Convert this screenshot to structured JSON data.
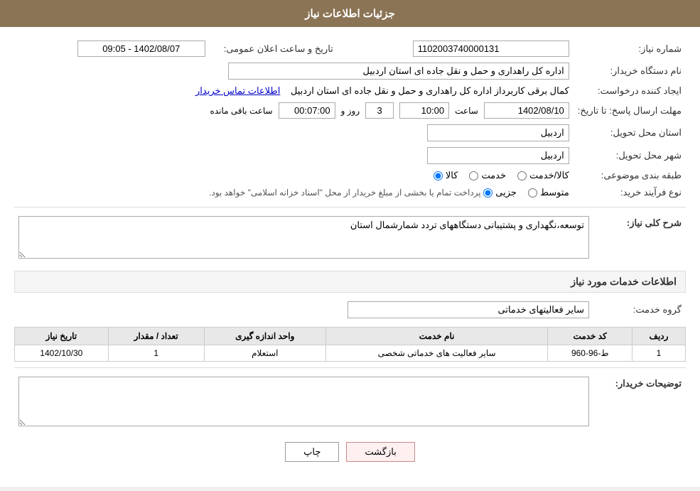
{
  "header": {
    "title": "جزئیات اطلاعات نیاز"
  },
  "form": {
    "need_number_label": "شماره نیاز:",
    "need_number_value": "1102003740000131",
    "org_name_label": "نام دستگاه خریدار:",
    "org_name_value": "اداره کل راهداری و حمل و نقل جاده ای استان اردبیل",
    "announce_label": "تاریخ و ساعت اعلان عمومی:",
    "announce_value": "1402/08/07 - 09:05",
    "requester_label": "ایجاد کننده درخواست:",
    "requester_value": "کمال برقی کاربرداز اداره کل راهداری و حمل و نقل جاده ای استان اردبیل",
    "contact_link": "اطلاعات تماس خریدار",
    "deadline_label": "مهلت ارسال پاسخ: تا تاریخ:",
    "deadline_date": "1402/08/10",
    "deadline_time_label": "ساعت",
    "deadline_time": "10:00",
    "deadline_days_label": "روز و",
    "deadline_days": "3",
    "deadline_remaining_label": "ساعت باقی مانده",
    "deadline_remaining": "00:07:00",
    "province_label": "استان محل تحویل:",
    "province_value": "اردبیل",
    "city_label": "شهر محل تحویل:",
    "city_value": "اردبیل",
    "category_label": "طبقه بندی موضوعی:",
    "category_options": [
      "کالا",
      "خدمت",
      "کالا/خدمت"
    ],
    "category_selected": "کالا",
    "process_label": "نوع فرآیند خرید:",
    "process_options": [
      "جزیی",
      "متوسط"
    ],
    "process_note": "پرداخت تمام یا بخشی از مبلغ خریدار از محل \"اسناد خزانه اسلامی\" خواهد بود.",
    "description_label": "شرح کلی نیاز:",
    "description_value": "توسعه،نگهداری و پشتیبانی دستگاههای تردد شمارشمال استان",
    "services_section": "اطلاعات خدمات مورد نیاز",
    "service_group_label": "گروه خدمت:",
    "service_group_value": "سایر فعالیتهای خدماتی",
    "table": {
      "columns": [
        "ردیف",
        "کد خدمت",
        "نام خدمت",
        "واحد اندازه گیری",
        "تعداد / مقدار",
        "تاریخ نیاز"
      ],
      "rows": [
        {
          "row_num": "1",
          "service_code": "ط-96-960",
          "service_name": "سایر فعالیت های خدماتی شخصی",
          "unit": "استعلام",
          "qty": "1",
          "date": "1402/10/30"
        }
      ]
    },
    "buyer_notes_label": "توضیحات خریدار:",
    "buyer_notes_value": "",
    "btn_print": "چاپ",
    "btn_back": "بازگشت"
  }
}
